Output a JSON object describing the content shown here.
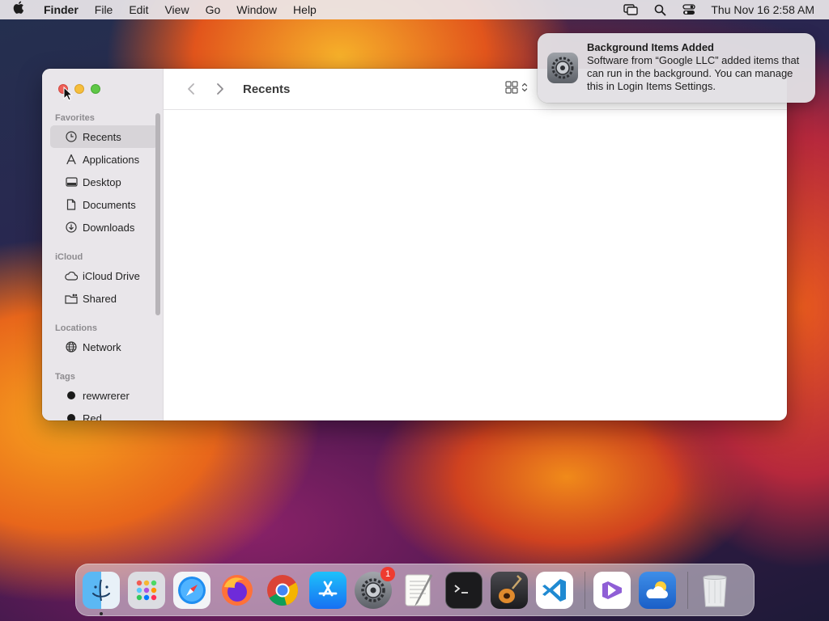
{
  "menubar": {
    "app_name": "Finder",
    "menus": [
      "File",
      "Edit",
      "View",
      "Go",
      "Window",
      "Help"
    ],
    "clock": "Thu Nov 16  2:58 AM"
  },
  "window": {
    "title": "Recents",
    "sidebar": {
      "favorites_label": "Favorites",
      "favorites": [
        "Recents",
        "Applications",
        "Desktop",
        "Documents",
        "Downloads"
      ],
      "icloud_label": "iCloud",
      "icloud": [
        "iCloud Drive",
        "Shared"
      ],
      "locations_label": "Locations",
      "locations": [
        "Network"
      ],
      "tags_label": "Tags",
      "tags": [
        "rewwrerer",
        "Red"
      ]
    }
  },
  "notification": {
    "title": "Background Items Added",
    "body": "Software from “Google LLC” added items that can run in the background. You can manage this in Login Items Settings."
  },
  "dock": {
    "apps": [
      "finder",
      "launchpad",
      "safari",
      "firefox",
      "chrome",
      "app-store",
      "system-settings",
      "textedit",
      "terminal",
      "garageband",
      "vscode",
      "visual-studio",
      "weather",
      "trash"
    ],
    "settings_badge": "1"
  }
}
